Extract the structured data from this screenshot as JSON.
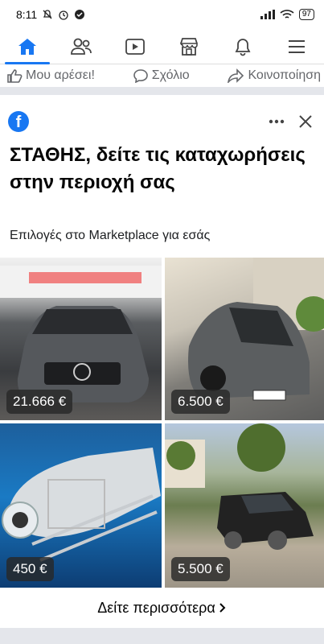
{
  "status": {
    "time": "8:11",
    "battery": "97"
  },
  "nav": {
    "items": [
      {
        "name": "home",
        "icon": "home-icon",
        "active": true
      },
      {
        "name": "friends",
        "icon": "friends-icon"
      },
      {
        "name": "watch",
        "icon": "video-icon"
      },
      {
        "name": "marketplace",
        "icon": "marketplace-icon"
      },
      {
        "name": "notifications",
        "icon": "bell-icon"
      },
      {
        "name": "menu",
        "icon": "menu-icon"
      }
    ],
    "accent": "#1877f2"
  },
  "actions": {
    "like": "Μου αρέσει!",
    "comment": "Σχόλιο",
    "share": "Κοινοποίηση"
  },
  "card": {
    "logo": "f",
    "title": "ΣΤΑΘΗΣ, δείτε τις καταχωρήσεις στην περιοχή σας",
    "subtitle": "Επιλογές στο Marketplace για εσάς",
    "listings": [
      {
        "price": "21.666 €"
      },
      {
        "price": "6.500 €"
      },
      {
        "price": "450 €"
      },
      {
        "price": "5.500 €"
      }
    ],
    "see_more": "Δείτε περισσότερα"
  }
}
